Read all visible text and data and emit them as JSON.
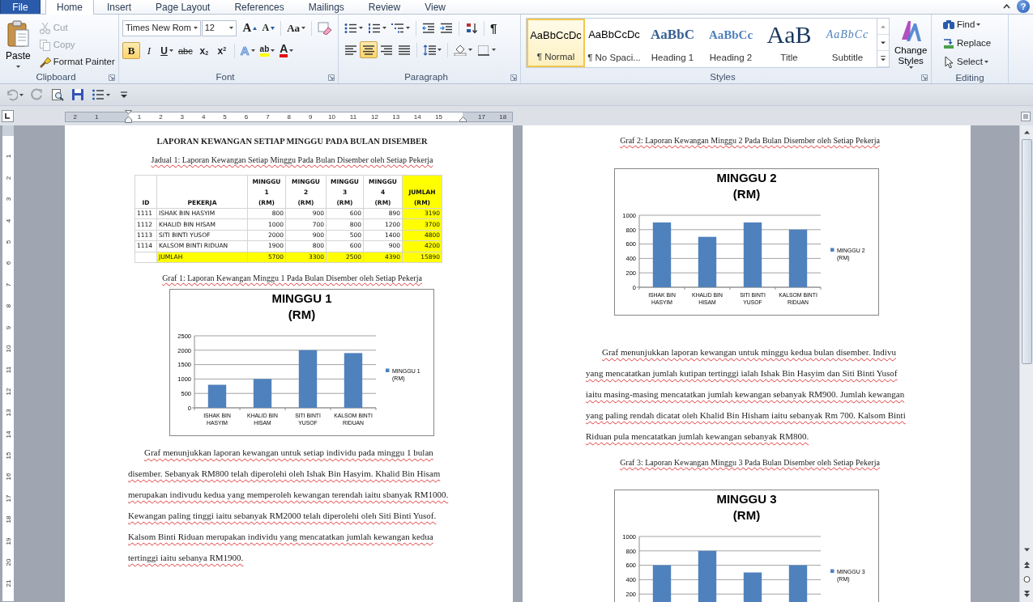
{
  "tabs": [
    {
      "label": "File",
      "kind": "file",
      "selected": false
    },
    {
      "label": "Home",
      "kind": "tab",
      "selected": true
    },
    {
      "label": "Insert",
      "kind": "tab",
      "selected": false
    },
    {
      "label": "Page Layout",
      "kind": "tab",
      "selected": false
    },
    {
      "label": "References",
      "kind": "tab",
      "selected": false
    },
    {
      "label": "Mailings",
      "kind": "tab",
      "selected": false
    },
    {
      "label": "Review",
      "kind": "tab",
      "selected": false
    },
    {
      "label": "View",
      "kind": "tab",
      "selected": false
    }
  ],
  "window_controls": {
    "help": "?"
  },
  "clipboard": {
    "label": "Clipboard",
    "paste": "Paste",
    "cut": {
      "label": "Cut",
      "disabled": true
    },
    "copy": {
      "label": "Copy",
      "disabled": true
    },
    "format_painter": {
      "label": "Format Painter",
      "disabled": false
    }
  },
  "font": {
    "label": "Font",
    "font_name": "Times New Rom",
    "font_size": "12",
    "size_buttons": [
      {
        "glyph": "A",
        "kind": "grow"
      },
      {
        "glyph": "A",
        "kind": "shrink"
      }
    ],
    "case_button": "Aa",
    "buttons": [
      {
        "glyph": "B",
        "kind": "bold",
        "selected": true,
        "dropdown": false
      },
      {
        "glyph": "I",
        "kind": "italic",
        "selected": false,
        "dropdown": false
      },
      {
        "glyph": "U",
        "kind": "underline",
        "selected": false,
        "dropdown": true
      },
      {
        "glyph": "abc",
        "kind": "strike",
        "selected": false,
        "dropdown": false
      },
      {
        "glyph": "x$_{2}$",
        "kind": "subscript",
        "selected": false,
        "dropdown": false
      },
      {
        "glyph": "x$^{2}$",
        "kind": "superscript",
        "selected": false,
        "dropdown": false
      },
      {
        "glyph": "A",
        "kind": "effects",
        "selected": false,
        "dropdown": true
      },
      {
        "glyph": "ab",
        "kind": "highlight",
        "selected": false,
        "dropdown": true
      },
      {
        "glyph": "A",
        "kind": "color",
        "selected": false,
        "dropdown": true
      }
    ]
  },
  "paragraph": {
    "label": "Paragraph",
    "pilcrow": "¶",
    "align_buttons": [
      {
        "kind": "left",
        "selected": false
      },
      {
        "kind": "center",
        "selected": true
      },
      {
        "kind": "right",
        "selected": false
      },
      {
        "kind": "justify",
        "selected": false
      }
    ]
  },
  "styles": {
    "label": "Styles",
    "items": [
      {
        "preview": "AaBbCcDc",
        "name": "¶ Normal",
        "kind": "normal",
        "selected": true
      },
      {
        "preview": "AaBbCcDc",
        "name": "¶ No Spaci...",
        "kind": "nospacing",
        "selected": false
      },
      {
        "preview": "AaBbC",
        "name": "Heading 1",
        "kind": "heading1",
        "selected": false
      },
      {
        "preview": "AaBbCc",
        "name": "Heading 2",
        "kind": "heading2",
        "selected": false
      },
      {
        "preview": "AaB",
        "name": "Title",
        "kind": "title",
        "selected": false
      },
      {
        "preview": "AaBbCc",
        "name": "Subtitle",
        "kind": "subtitle",
        "selected": false
      }
    ],
    "change_styles": "Change\nStyles"
  },
  "editing": {
    "label": "Editing",
    "find": "Find",
    "replace": "Replace",
    "select": "Select"
  },
  "ruler": {
    "left_numbers": [
      "2",
      "1"
    ],
    "numbers": [
      "1",
      "2",
      "3",
      "4",
      "5",
      "6",
      "7",
      "8",
      "9",
      "10",
      "11",
      "12",
      "13",
      "14",
      "15",
      "17",
      "18"
    ]
  },
  "vertical_ruler": {
    "numbers": [
      "1",
      "2",
      "3",
      "4",
      "5",
      "6",
      "7",
      "8",
      "9",
      "10",
      "11",
      "12",
      "13",
      "14",
      "15",
      "16",
      "17",
      "18",
      "19",
      "20",
      "21"
    ]
  },
  "page_1": {
    "title": "LAPORAN KEWANGAN SETIAP MINGGU PADA BULAN DISEMBER",
    "table_caption": "Jadual 1: Laporan Kewangan Setiap Minggu Pada Bulan Disember oleh Setiap Pekerja",
    "table": {
      "columns": [
        "ID",
        "PEKERJA",
        "MINGGU\n1\n(RM)",
        "MINGGU\n2\n(RM)",
        "MINGGU\n3\n(RM)",
        "MINGGU\n4\n(RM)",
        "JUMLAH\n(RM)"
      ],
      "rows": [
        {
          "id": "1111",
          "name": "ISHAK BIN HASYIM",
          "values": [
            "800",
            "900",
            "600",
            "890"
          ],
          "total": "3190"
        },
        {
          "id": "1112",
          "name": "KHALID BIN HISAM",
          "values": [
            "1000",
            "700",
            "800",
            "1200"
          ],
          "total": "3700"
        },
        {
          "id": "1113",
          "name": "SITI BINTI YUSOF",
          "values": [
            "2000",
            "900",
            "500",
            "1400"
          ],
          "total": "4800"
        },
        {
          "id": "1114",
          "name": "KALSOM BINTI RIDUAN",
          "values": [
            "1900",
            "800",
            "600",
            "900"
          ],
          "total": "4200"
        }
      ],
      "total_row": {
        "label": "JUMLAH",
        "values": [
          "5700",
          "3300",
          "2500",
          "4390"
        ],
        "total": "15890"
      }
    },
    "chart_caption": "Graf 1: Laporan Kewangan Minggu 1 Pada Bulan Disember oleh Setiap Pekerja",
    "chart_data": {
      "type": "bar",
      "title": "MINGGU 1\n(RM)",
      "categories": [
        "ISHAK BIN\nHASYIM",
        "KHALID BIN\nHISAM",
        "SITI BINTI\nYUSOF",
        "KALSOM BINTI\nRIDUAN"
      ],
      "series": [
        {
          "name": "MINGGU 1\n(RM)",
          "color": "#4f81bd",
          "values": [
            800,
            1000,
            2000,
            1900
          ]
        }
      ],
      "ylim": [
        0,
        2500
      ],
      "yticks": [
        0,
        500,
        1000,
        1500,
        2000,
        2500
      ],
      "grid": true
    },
    "paragraph": "Graf menunjukkan laporan kewangan untuk setiap individu pada minggu 1 bulan disember. Sebanyak RM800 telah diperolehi oleh Ishak Bin Hasyim. Khalid Bin Hisam merupakan indivudu kedua yang memperoleh kewangan terendah iaitu sbanyak RM1000. Kewangan paling tinggi  iaitu sebanyak RM2000 telah diperolehi oleh Siti Binti Yusof. Kalsom Binti Riduan merupakan individu yang mencatatkan jumlah kewangan kedua tertinggi  iaitu sebanya RM1900."
  },
  "page_2": {
    "chart_caption": "Graf 2: Laporan Kewangan Minggu 2 Pada Bulan Disember oleh Setiap Pekerja",
    "chart_data": {
      "type": "bar",
      "title": "MINGGU 2\n(RM)",
      "categories": [
        "ISHAK BIN\nHASYIM",
        "KHALID BIN\nHISAM",
        "SITI BINTI\nYUSOF",
        "KALSOM BINTI\nRIDUAN"
      ],
      "series": [
        {
          "name": "MINGGU 2\n(RM)",
          "color": "#4f81bd",
          "values": [
            900,
            700,
            900,
            800
          ]
        }
      ],
      "ylim": [
        0,
        1000
      ],
      "yticks": [
        0,
        200,
        400,
        600,
        800,
        1000
      ],
      "grid": true
    },
    "paragraph": "Graf menunjukkan laporan kewangan untuk minggu kedua bulan disember. Indivu yang mencatatkan jumlah kutipan tertinggi ialah Ishak Bin Hasyim dan Siti Binti Yusof iaitu masing-masing mencatatkan jumlah kewangan sebanyak RM900. Jumlah kewangan yang paling rendah dicatat oleh Khalid Bin Hisham iaitu sebanyak Rm 700. Kalsom Binti Riduan pula mencatatkan jumlah kewangan sebanyak RM800.",
    "graph_3": {
      "caption": "Graf 3: Laporan Kewangan Minggu 3 Pada Bulan Disember oleh Setiap Pekerja",
      "chart_data": {
        "type": "bar",
        "title": "MINGGU 3\n(RM)",
        "series": [
          {
            "name": "MINGGU 3\n(RM)",
            "color": "#4f81bd",
            "values": [
              600,
              800,
              500,
              600
            ]
          }
        ],
        "ylim": [
          0,
          1000
        ],
        "yticks": [
          200,
          400,
          600,
          800,
          1000
        ],
        "grid": true
      }
    }
  }
}
